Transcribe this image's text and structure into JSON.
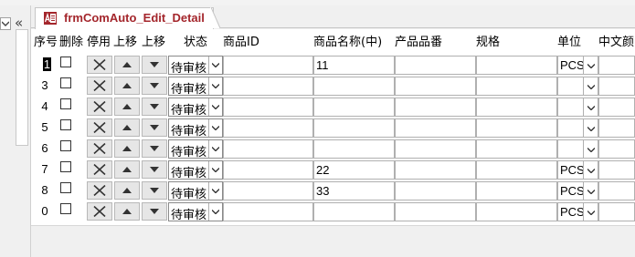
{
  "form": {
    "tab_title": "frmComAuto_Edit_Detail",
    "headers": {
      "seq": "序号",
      "delete": "删除",
      "disable": "停用",
      "move_up": "上移",
      "move_down": "上移",
      "status": "状态",
      "product_id": "商品ID",
      "product_name": "商品名称(中)",
      "product_code": "产品品番",
      "spec": "规格",
      "unit": "单位",
      "cn_color": "中文颜"
    },
    "rows": [
      {
        "seq": "1",
        "status": "待审核",
        "product_id": "",
        "product_name": "11",
        "product_code": "",
        "spec": "",
        "unit": "PCS",
        "cn_color": ""
      },
      {
        "seq": "3",
        "status": "待审核",
        "product_id": "",
        "product_name": "",
        "product_code": "",
        "spec": "",
        "unit": "",
        "cn_color": ""
      },
      {
        "seq": "4",
        "status": "待审核",
        "product_id": "",
        "product_name": "",
        "product_code": "",
        "spec": "",
        "unit": "",
        "cn_color": ""
      },
      {
        "seq": "5",
        "status": "待审核",
        "product_id": "",
        "product_name": "",
        "product_code": "",
        "spec": "",
        "unit": "",
        "cn_color": ""
      },
      {
        "seq": "6",
        "status": "待审核",
        "product_id": "",
        "product_name": "",
        "product_code": "",
        "spec": "",
        "unit": "",
        "cn_color": ""
      },
      {
        "seq": "7",
        "status": "待审核",
        "product_id": "",
        "product_name": "22",
        "product_code": "",
        "spec": "",
        "unit": "PCS",
        "cn_color": ""
      },
      {
        "seq": "8",
        "status": "待审核",
        "product_id": "",
        "product_name": "33",
        "product_code": "",
        "spec": "",
        "unit": "PCS",
        "cn_color": ""
      },
      {
        "seq": "0",
        "status": "待审核",
        "product_id": "",
        "product_name": "",
        "product_code": "",
        "spec": "",
        "unit": "PCS",
        "cn_color": ""
      }
    ],
    "active_row": 0
  },
  "icons": {
    "tab": "access-form-icon",
    "delete": "close-x-icon",
    "move_up": "triangle-up-icon",
    "move_down": "triangle-down-icon",
    "combo": "chevron-down-icon",
    "nav_collapse": "double-chevron-left-icon"
  },
  "colors": {
    "tab_title": "#a4262c",
    "button_face": "#e6e6e6",
    "background": "#f0f0f0"
  }
}
